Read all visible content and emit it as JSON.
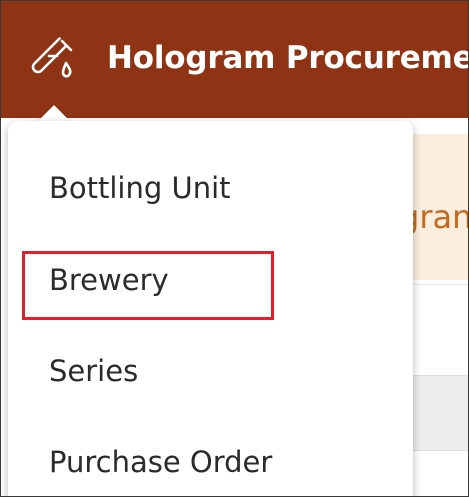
{
  "header": {
    "title": "Hologram Procurement",
    "icon": "test-tube-icon",
    "background": "#8e3414"
  },
  "banner": {
    "text": "gran",
    "text_color": "#c46a1e",
    "background": "#fbeede"
  },
  "dropdown": {
    "items": [
      {
        "label": "Bottling Unit"
      },
      {
        "label": "Brewery"
      },
      {
        "label": "Series"
      },
      {
        "label": "Purchase Order"
      }
    ],
    "highlighted_item": "Brewery",
    "highlight_color": "#e0202a"
  }
}
